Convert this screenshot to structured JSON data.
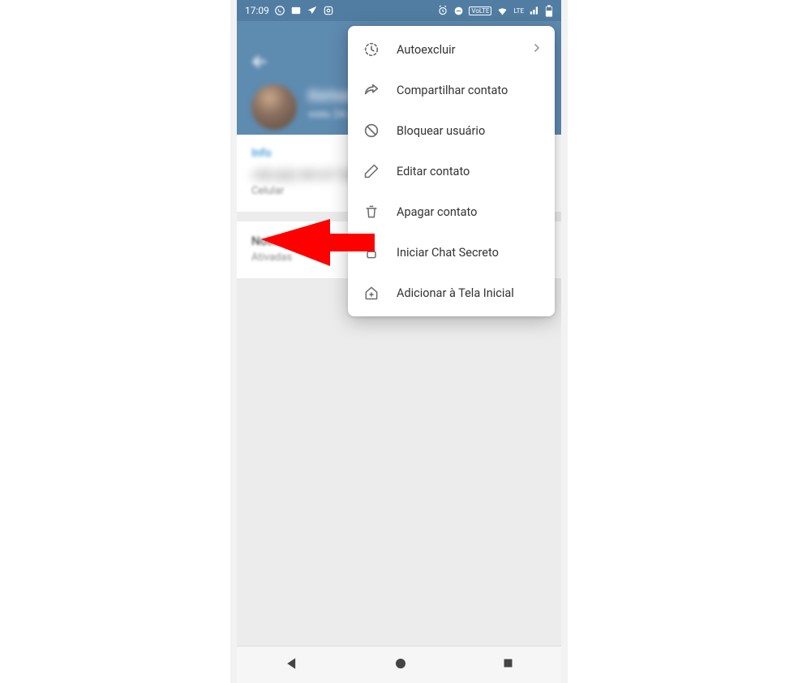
{
  "statusbar": {
    "time": "17:09",
    "icons_left": [
      "whatsapp-icon",
      "message-icon",
      "telegram-icon",
      "instagram-icon"
    ],
    "icons_right": [
      "alarm-icon",
      "dnd-icon",
      "volte-icon",
      "wifi-icon",
      "lte-icon",
      "signal-icon",
      "battery-icon"
    ]
  },
  "header": {
    "contact_name": "Bárbara",
    "last_seen": "visto 24 de jun"
  },
  "info": {
    "label": "Info",
    "phone": "+55 (62) 99137-7241",
    "phone_caption": "Celular"
  },
  "notifications": {
    "title": "Notificações",
    "value": "Ativadas"
  },
  "menu": {
    "items": [
      {
        "icon": "timer-icon",
        "label": "Autoexcluir",
        "has_chevron": true
      },
      {
        "icon": "share-icon",
        "label": "Compartilhar contato"
      },
      {
        "icon": "block-icon",
        "label": "Bloquear usuário"
      },
      {
        "icon": "pencil-icon",
        "label": "Editar contato"
      },
      {
        "icon": "trash-icon",
        "label": "Apagar contato"
      },
      {
        "icon": "lock-icon",
        "label": "Iniciar Chat Secreto"
      },
      {
        "icon": "home-add-icon",
        "label": "Adicionar à Tela Inicial"
      }
    ]
  }
}
